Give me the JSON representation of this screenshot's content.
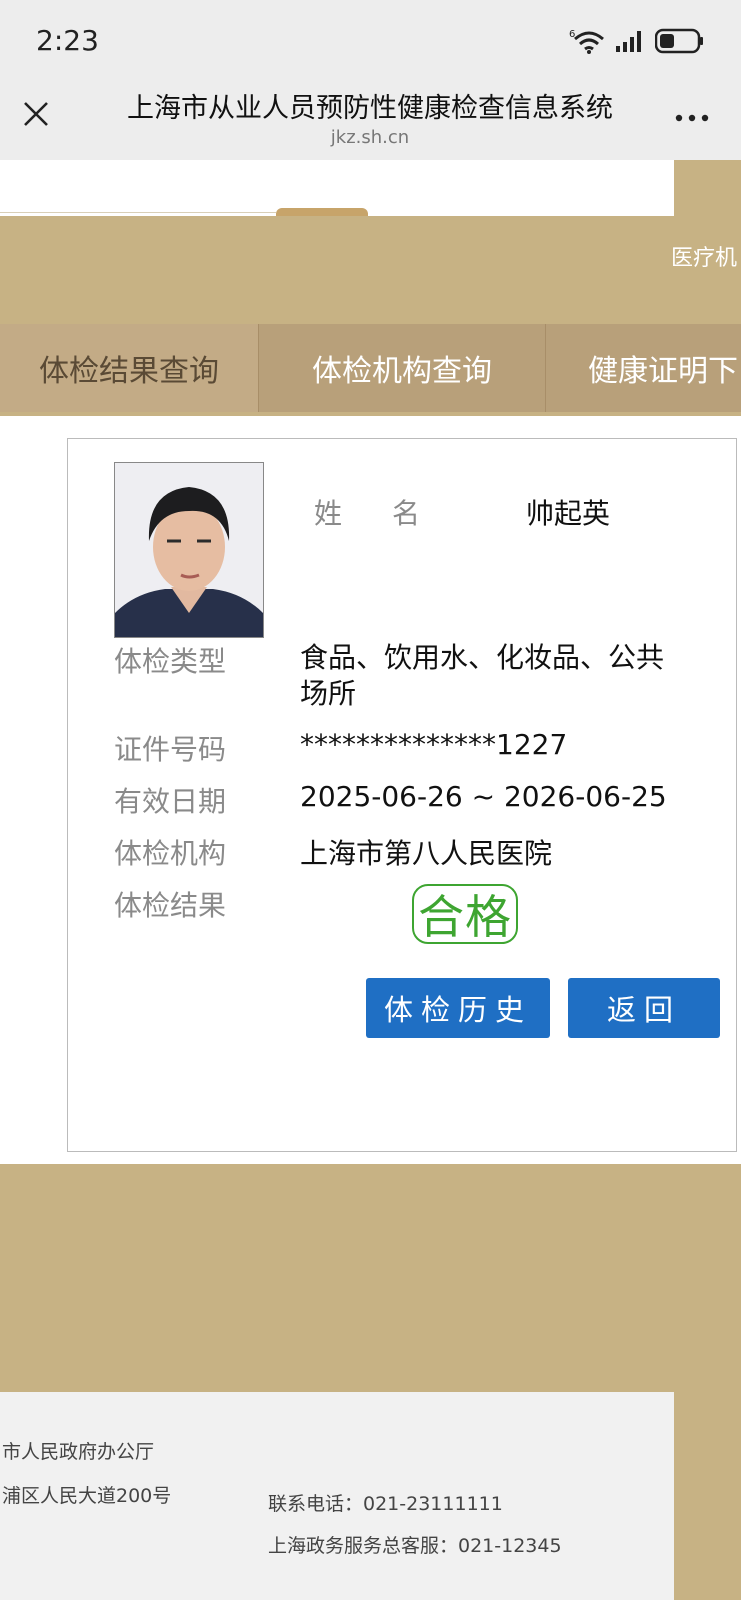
{
  "status_bar": {
    "time": "2:23"
  },
  "browser": {
    "title": "上海市从业人员预防性健康检查信息系统",
    "url": "jkz.sh.cn"
  },
  "header": {
    "org_link": "医疗机"
  },
  "nav": {
    "items": [
      {
        "label": "体检结果查询",
        "active": true
      },
      {
        "label": "体检机构查询",
        "active": false
      },
      {
        "label": "健康证明下",
        "active": false
      }
    ]
  },
  "record": {
    "name_label": "姓名",
    "name_value": "帅起英",
    "fields": [
      {
        "label": "体检类型",
        "value": "食品、饮用水、化妆品、公共场所"
      },
      {
        "label": "证件号码",
        "value": "**************1227"
      },
      {
        "label": "有效日期",
        "value": "2025-06-26 ~ 2026-06-25"
      },
      {
        "label": "体检机构",
        "value": "上海市第八人民医院"
      },
      {
        "label": "体检结果",
        "value": ""
      }
    ],
    "result_stamp": "合格",
    "stamp_color": "#3ea531"
  },
  "buttons": {
    "history": "体检历史",
    "back": "返回",
    "color": "#1f6fc4"
  },
  "footer": {
    "sponsor": "市人民政府办公厅",
    "address": "浦区人民大道200号",
    "phone": "联系电话：021-23111111",
    "hotline": "上海政务服务总客服：021-12345"
  },
  "colors": {
    "gold": "#c7b284",
    "nav": "#b8a07a"
  }
}
